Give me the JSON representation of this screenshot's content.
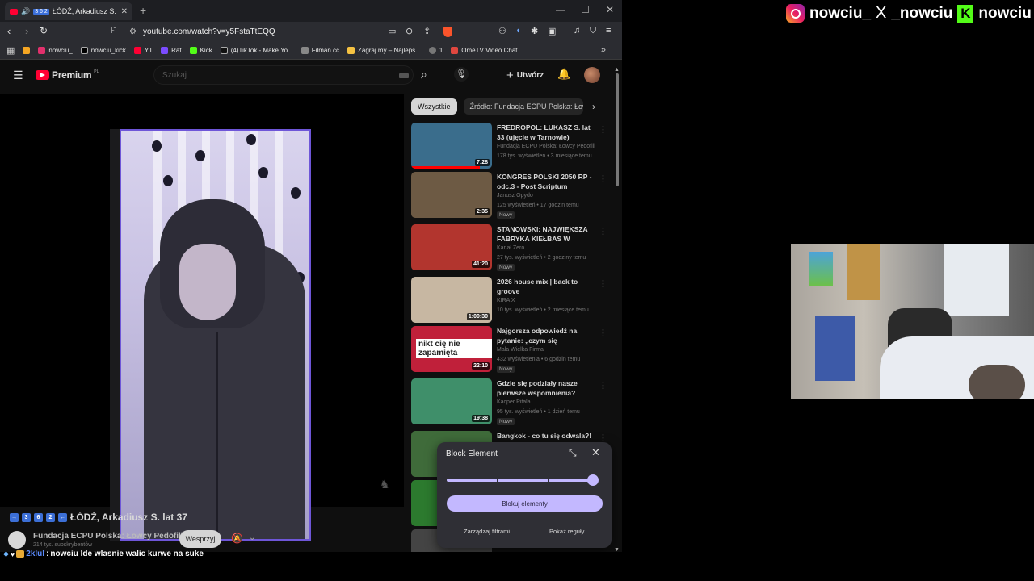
{
  "browser": {
    "tab": {
      "title": "ŁÓDŹ, Arkadiusz S. lat 37",
      "badge": "3 6 2"
    },
    "url": "youtube.com/watch?v=y5FstaTtEQQ",
    "bookmarks": [
      {
        "label": "nowciu_",
        "color": "#e1306c"
      },
      {
        "label": "nowciu_kick",
        "color": "#000000"
      },
      {
        "label": "YT",
        "color": "#ff0033"
      },
      {
        "label": "Rat",
        "color": "#7b4cff"
      },
      {
        "label": "Kick",
        "color": "#53fc18"
      },
      {
        "label": "(4)TikTok - Make Yo...",
        "color": "#111111"
      },
      {
        "label": "Filman.cc",
        "color": "#888888"
      },
      {
        "label": "Zagraj.my – Najleps...",
        "color": "#f5c242"
      },
      {
        "label": "1",
        "color": "#777777"
      },
      {
        "label": "OmeTV Video Chat...",
        "color": "#e0473f"
      }
    ]
  },
  "youtube": {
    "logo": "Premium",
    "logo_region": "PL",
    "search_placeholder": "Szukaj",
    "create_label": "Utwórz",
    "video": {
      "title": "ŁÓDŹ, Arkadiusz S. lat 37",
      "title_badges": [
        "→",
        "3",
        "6",
        "2",
        "←"
      ],
      "channel": "Fundacja ECPU Polska: Łowcy Pedofili",
      "subscribers": "214 tys. subskrybentów",
      "support_label": "Wesprzyj"
    },
    "chips": [
      "Wszystkie",
      "Źródło: Fundacja ECPU Polska: Łowcy"
    ],
    "recommendations": [
      {
        "title": "FREDROPOL: ŁUKASZ S. lat 33 (ujęcie w Tarnowie)",
        "channel": "Fundacja ECPU Polska: Łowcy Pedofili",
        "meta": "178 tys. wyświetleń • 3 miesiące temu",
        "duration": "7:28",
        "badge": "",
        "thumb": "#3a6d8c",
        "progress": 0.85,
        "thumb_text": ""
      },
      {
        "title": "KONGRES POLSKI 2050 RP - odc.3 - Post Scriptum",
        "channel": "Janusz Opydo",
        "meta": "125 wyświetleń • 17 godzin temu",
        "duration": "2:35",
        "badge": "Nowy",
        "thumb": "#6d5a44",
        "progress": 0,
        "thumb_text": ""
      },
      {
        "title": "STANOWSKI: NAJWIĘKSZA FABRYKA KIEŁBAS W POLSCE",
        "channel": "Kanał Zero",
        "meta": "27 tys. wyświetleń • 2 godziny temu",
        "duration": "41:20",
        "badge": "Nowy",
        "thumb": "#b2352e",
        "progress": 0,
        "thumb_text": ""
      },
      {
        "title": "2026 house mix | back to groove",
        "channel": "KIRA X",
        "meta": "10 tys. wyświetleń • 2 miesiące temu",
        "duration": "1:00:30",
        "badge": "",
        "thumb": "#c7b7a2",
        "progress": 0,
        "thumb_text": ""
      },
      {
        "title": "Najgorsza odpowiedź na pytanie: „czym się zajmujesz?”",
        "channel": "Mała Wielka Firma",
        "meta": "432 wyświetlenia • 6 godzin temu",
        "duration": "22:10",
        "badge": "Nowy",
        "thumb": "#c0203a",
        "progress": 0,
        "thumb_text": "nikt cię nie zapamięta"
      },
      {
        "title": "Gdzie się podziały nasze pierwsze wspomnienia?",
        "channel": "Kacper Pitala",
        "meta": "95 tys. wyświetleń • 1 dzień temu",
        "duration": "19:38",
        "badge": "Nowy",
        "thumb": "#3f8f6a",
        "progress": 0,
        "thumb_text": ""
      },
      {
        "title": "Bangkok - co tu się odwala?!",
        "channel": "",
        "meta": "",
        "duration": "",
        "badge": "",
        "thumb": "#3f6b3a",
        "progress": 0,
        "thumb_text": ""
      },
      {
        "title": "",
        "channel": "",
        "meta": "",
        "duration": "",
        "badge": "",
        "thumb": "#2c7a2e",
        "progress": 0,
        "thumb_text": ""
      },
      {
        "title": "",
        "channel": "",
        "meta": "",
        "duration": "",
        "badge": "",
        "thumb": "#444444",
        "progress": 0,
        "thumb_text": ""
      }
    ]
  },
  "block_panel": {
    "title": "Block Element",
    "primary": "Blokuj elementy",
    "manage": "Zarządzaj filtrami",
    "rules": "Pokaż reguły",
    "slider_value": 1.0
  },
  "chat": {
    "user": "2klul",
    "separator": ":",
    "message": "nowciu Ide wlasnie walic kurwe na suke"
  },
  "socials": {
    "instagram": "nowciu_",
    "x": "_nowciu",
    "kick": "nowciu"
  },
  "icons": {
    "x": "X",
    "kick": "K"
  },
  "colors": {
    "accent": "#c3b8ff",
    "yt_red": "#ff0033",
    "kick_green": "#53fc18",
    "selection_border": "#6e56d8"
  }
}
